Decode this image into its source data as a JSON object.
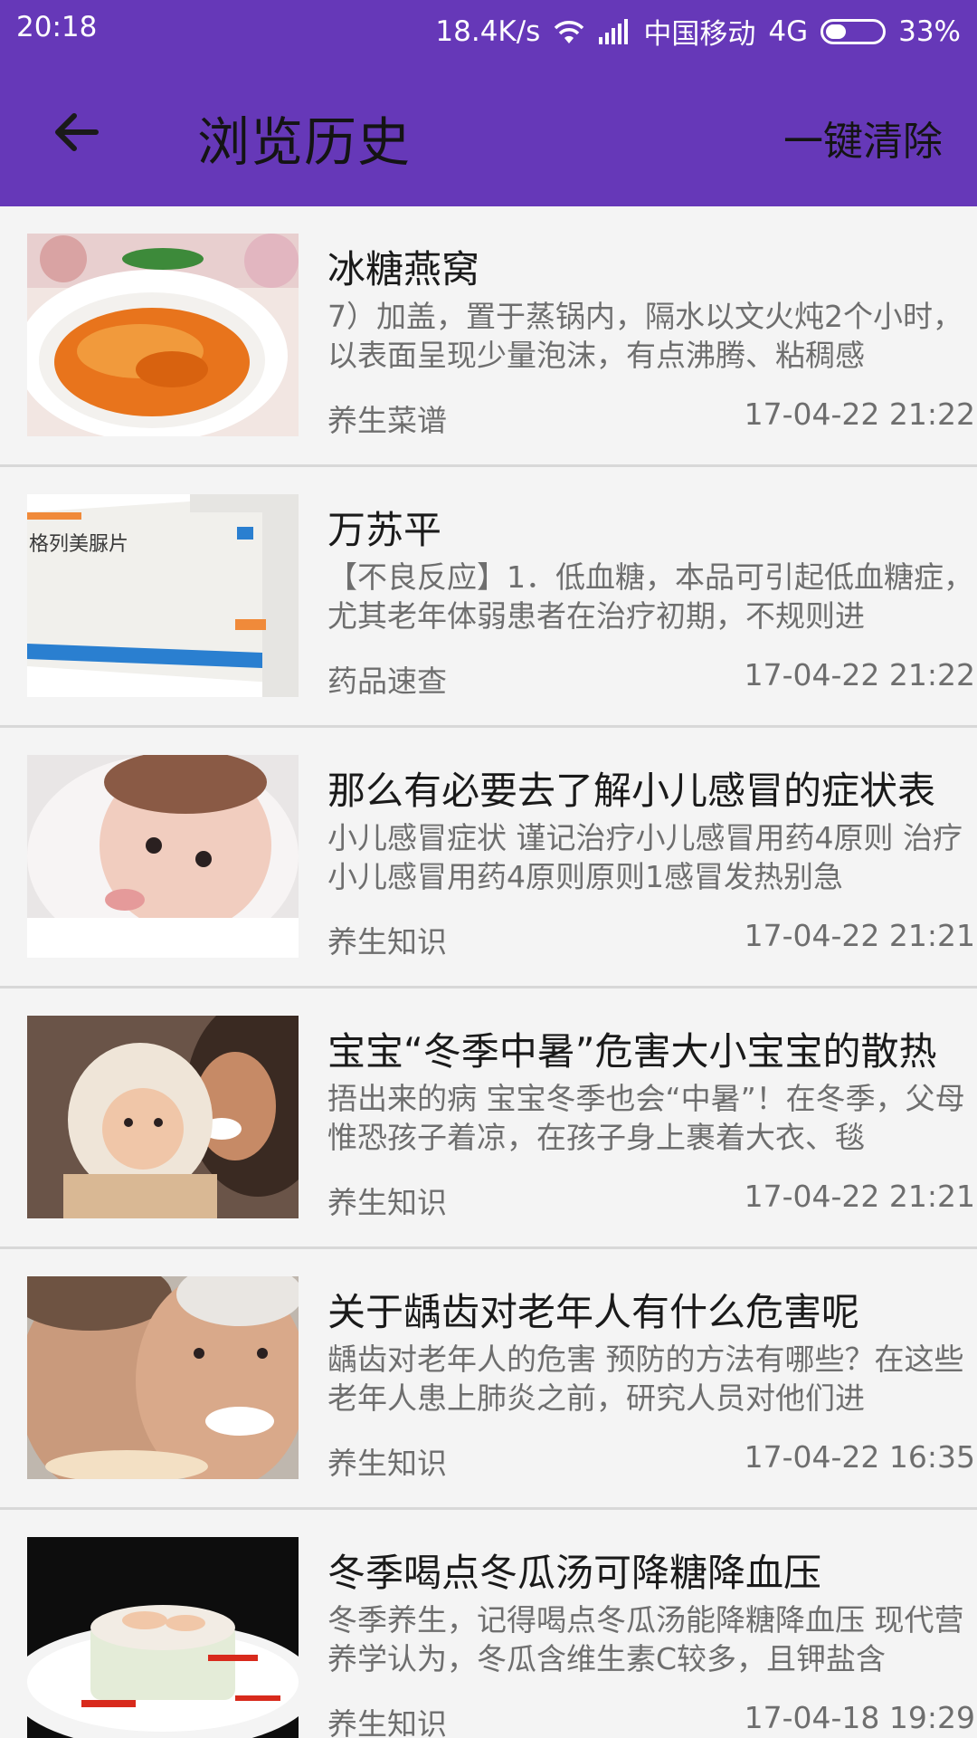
{
  "status_bar": {
    "time": "20:18",
    "speed": "18.4K/s",
    "carrier": "中国移动",
    "network": "4G",
    "battery": "33%",
    "icons": [
      "wifi-icon",
      "signal-icon",
      "battery-icon"
    ]
  },
  "app_bar": {
    "title": "浏览历史",
    "back_icon": "back-arrow-icon",
    "clear_label": "一键清除"
  },
  "colors": {
    "primary": "#6638b8",
    "background": "#f4f4f4",
    "divider": "#d8d8d8"
  },
  "items": [
    {
      "title": "冰糖燕窝",
      "desc": "7）加盖，置于蒸锅内，隔水以文火炖2个小时，以表面呈现少量泡沫，有点沸腾、粘稠感",
      "category": "养生菜谱",
      "time": "17-04-22 21:22",
      "thumb": "bird-nest-soup-image"
    },
    {
      "title": "万苏平",
      "desc": "【不良反应】1．低血糖，本品可引起低血糖症，尤其老年体弱患者在治疗初期，不规则进",
      "category": "药品速查",
      "time": "17-04-22 21:22",
      "thumb": "medicine-box-image",
      "thumb_text": "格列美脲片"
    },
    {
      "title": "那么有必要去了解小儿感冒的症状表",
      "desc": "小儿感冒症状 谨记治疗小儿感冒用药4原则 治疗小儿感冒用药4原则原则1感冒发热别急",
      "category": "养生知识",
      "time": "17-04-22 21:21",
      "thumb": "baby-image"
    },
    {
      "title": "宝宝“冬季中暑”危害大小宝宝的散热",
      "desc": "捂出来的病 宝宝冬季也会“中暑”！在冬季，父母惟恐孩子着凉，在孩子身上裹着大衣、毯",
      "category": "养生知识",
      "time": "17-04-22 21:21",
      "thumb": "mother-baby-image"
    },
    {
      "title": "关于龋齿对老年人有什么危害呢",
      "desc": "龋齿对老年人的危害 预防的方法有哪些？在这些老年人患上肺炎之前，研究人员对他们进",
      "category": "养生知识",
      "time": "17-04-22 16:35",
      "thumb": "elderly-couple-image"
    },
    {
      "title": "冬季喝点冬瓜汤可降糖降血压",
      "desc": "冬季养生，记得喝点冬瓜汤能降糖降血压 现代营养学认为，冬瓜含维生素C较多，且钾盐含",
      "category": "养生知识",
      "time": "17-04-18 19:29",
      "thumb": "winter-melon-dish-image"
    }
  ]
}
